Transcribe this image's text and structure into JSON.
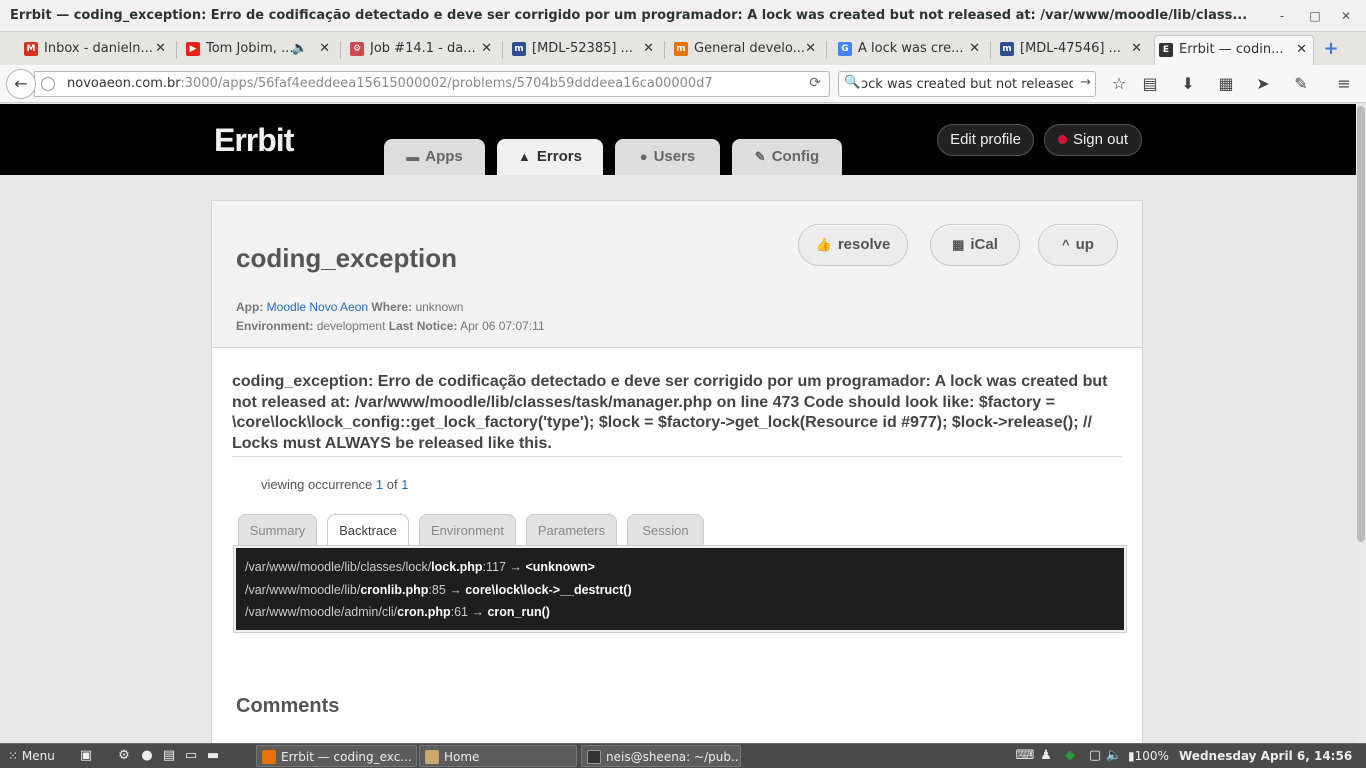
{
  "window": {
    "title": "Errbit — coding_exception: Erro de codificação detectado e deve ser corrigido por um programador: A lock was created but not released at: /var/www/moodle/lib/class...",
    "minimize": "-",
    "maximize": "□",
    "close": "✕"
  },
  "tabs": [
    {
      "label": "Inbox - danieln...",
      "icon_color": "#d93025",
      "icon_text": "M"
    },
    {
      "label": "Tom Jobim, ...",
      "icon_color": "#e62117",
      "icon_text": "▶"
    },
    {
      "label": "Job #14.1 - da...",
      "icon_color": "#c94b4b",
      "icon_text": "⚙"
    },
    {
      "label": "[MDL-52385] ...",
      "icon_color": "#2f4f8f",
      "icon_text": "m"
    },
    {
      "label": "General develo...",
      "icon_color": "#e8730a",
      "icon_text": "m"
    },
    {
      "label": "A lock was cre...",
      "icon_color": "#4285f4",
      "icon_text": "G"
    },
    {
      "label": "[MDL-47546] ...",
      "icon_color": "#2f4f8f",
      "icon_text": "m"
    },
    {
      "label": "Errbit — codin...",
      "icon_color": "#333333",
      "icon_text": "E"
    }
  ],
  "new_tab": "+",
  "nav": {
    "url_host": "novoaeon.com.br",
    "url_rest": ":3000/apps/56faf4eeddeea15615000002/problems/5704b59dddeea16ca00000d7",
    "search_value": "ɔck was created but not released at:"
  },
  "errbit": {
    "logo": "Errbit",
    "menu": [
      {
        "label": "Apps",
        "icon": "briefcase-icon",
        "glyph": "▬"
      },
      {
        "label": "Errors",
        "icon": "warning-icon",
        "glyph": "▲"
      },
      {
        "label": "Users",
        "icon": "users-icon",
        "glyph": "●"
      },
      {
        "label": "Config",
        "icon": "wrench-icon",
        "glyph": "✎"
      }
    ],
    "edit_profile": "Edit profile",
    "sign_out": "Sign out",
    "accent": "#d2143a"
  },
  "problem": {
    "title": "coding_exception",
    "app_label": "App:",
    "app_value": "Moodle Novo Aeon",
    "where_label": "Where:",
    "where_value": "unknown",
    "env_label": "Environment:",
    "env_value": "development",
    "last_notice_label": "Last Notice:",
    "last_notice_value": "Apr 06 07:07:11",
    "buttons": {
      "resolve": "resolve",
      "ical": "iCal",
      "up": "up"
    },
    "message": "coding_exception: Erro de codificação detectado e deve ser corrigido por um programador: A lock was created but not released at: /var/www/moodle/lib/classes/task/manager.php on line 473 Code should look like: $factory = \\core\\lock\\lock_config::get_lock_factory('type'); $lock = $factory->get_lock(Resource id #977); $lock->release(); // Locks must ALWAYS be released like this.",
    "occurrence": {
      "prefix": "viewing occurrence",
      "current": "1",
      "of": "of",
      "total": "1"
    },
    "subtabs": [
      "Summary",
      "Backtrace",
      "Environment",
      "Parameters",
      "Session"
    ],
    "backtrace": [
      {
        "path": "/var/www/moodle/lib/classes/lock/",
        "file": "lock.php",
        "line": ":117",
        "arrow": " → ",
        "method": "<unknown>"
      },
      {
        "path": "/var/www/moodle/lib/",
        "file": "cronlib.php",
        "line": ":85",
        "arrow": " → ",
        "method": "core\\lock\\lock->__destruct()"
      },
      {
        "path": "/var/www/moodle/admin/cli/",
        "file": "cron.php",
        "line": ":61",
        "arrow": " → ",
        "method": "cron_run()"
      }
    ],
    "comments_heading": "Comments"
  },
  "taskbar": {
    "menu": "Menu",
    "windows": [
      {
        "label": "Errbit — coding_exc...",
        "icon_color": "#e8730a"
      },
      {
        "label": "Home",
        "icon_color": "#c9a96e"
      },
      {
        "label": "neis@sheena: ~/pub...",
        "icon_color": "#333333"
      }
    ],
    "battery": "100%",
    "clock": "Wednesday April  6, 14:56"
  }
}
